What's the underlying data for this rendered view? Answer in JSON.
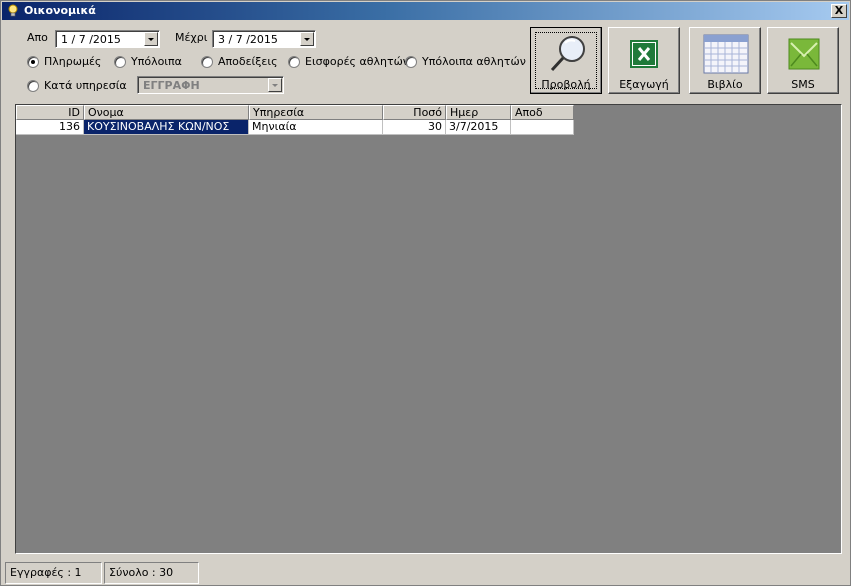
{
  "window": {
    "title": "Οικονομικά",
    "close_glyph": "X"
  },
  "filters": {
    "from_label": "Απο",
    "from_value": "1 / 7 /2015",
    "to_label": "Μέχρι",
    "to_value": "3 / 7 /2015",
    "radios": [
      {
        "label": "Πληρωμές",
        "checked": true
      },
      {
        "label": "Υπόλοιπα",
        "checked": false
      },
      {
        "label": "Αποδείξεις",
        "checked": false
      },
      {
        "label": "Εισφορές αθλητών",
        "checked": false
      },
      {
        "label": "Υπόλοιπα αθλητών",
        "checked": false
      },
      {
        "label": "Κατά υπηρεσία",
        "checked": false
      }
    ],
    "service_select": {
      "value": "ΕΓΓΡΑΦΗ",
      "disabled": true
    }
  },
  "toolbar": {
    "view_label": "Προβολή",
    "export_label": "Εξαγωγή",
    "book_label": "Βιβλίο",
    "sms_label": "SMS"
  },
  "grid": {
    "columns": [
      "ID",
      "Ονομα",
      "Υπηρεσία",
      "Ποσό",
      "Ημερ",
      "Αποδ"
    ],
    "rows": [
      {
        "id": "136",
        "name": "ΚΟΥΣΙΝΟΒΑΛΗΣ ΚΩΝ/ΝΟΣ",
        "service": "Μηνιαία",
        "amount": "30",
        "date": "3/7/2015",
        "receipt": ""
      }
    ]
  },
  "status": {
    "records": "Εγγραφές : 1",
    "total": "Σύνολο : 30"
  },
  "colors": {
    "title_start": "#0a246a",
    "title_end": "#a6caf0",
    "selection": "#0a246a",
    "excel_green": "#1f7a3a",
    "sms_green": "#7ab83a"
  }
}
